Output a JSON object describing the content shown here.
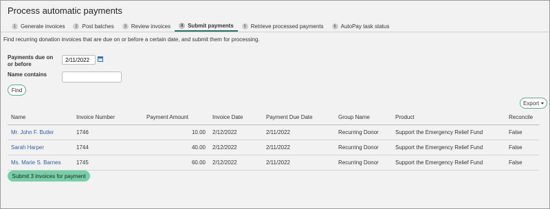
{
  "page": {
    "title": "Process automatic payments"
  },
  "tabs": [
    {
      "num": "1",
      "label": "Generate invoices"
    },
    {
      "num": "2",
      "label": "Post batches"
    },
    {
      "num": "3",
      "label": "Review invoices"
    },
    {
      "num": "4",
      "label": "Submit payments"
    },
    {
      "num": "5",
      "label": "Retrieve processed payments"
    },
    {
      "num": "6",
      "label": "AutoPay task status"
    }
  ],
  "active_tab": "Submit payments",
  "description": "Find recurring donation invoices that are due on or before a certain date, and submit them for processing.",
  "filters": {
    "due_label": "Payments due on or before",
    "due_value": "2/11/2022",
    "name_label": "Name contains",
    "name_value": "",
    "find_label": "Find"
  },
  "export_label": "Export",
  "table": {
    "columns": [
      "Name",
      "Invoice Number",
      "Payment Amount",
      "Invoice Date",
      "Payment Due Date",
      "Group Name",
      "Product",
      "Reconcile"
    ],
    "rows": [
      {
        "name": "Mr. John F. Butler",
        "invoice_number": "1746",
        "payment_amount": "10.00",
        "invoice_date": "2/12/2022",
        "due_date": "2/11/2022",
        "group": "Recurring Donor",
        "product": "Support the Emergency Relief Fund",
        "reconcile": "False"
      },
      {
        "name": "Sarah Harper",
        "invoice_number": "1744",
        "payment_amount": "40.00",
        "invoice_date": "2/12/2022",
        "due_date": "2/11/2022",
        "group": "Recurring Donor",
        "product": "Support the Emergency Relief Fund",
        "reconcile": "False"
      },
      {
        "name": "Ms. Marie S. Barnes",
        "invoice_number": "1745",
        "payment_amount": "60.00",
        "invoice_date": "2/12/2022",
        "due_date": "2/11/2022",
        "group": "Recurring Donor",
        "product": "Support the Emergency Relief Fund",
        "reconcile": "False"
      }
    ]
  },
  "submit_label": "Submit 3 invoices for payment",
  "colors": {
    "accent": "#78cfa7",
    "link": "#2f5f9e",
    "active_tab_underline": "#2a6f67"
  }
}
